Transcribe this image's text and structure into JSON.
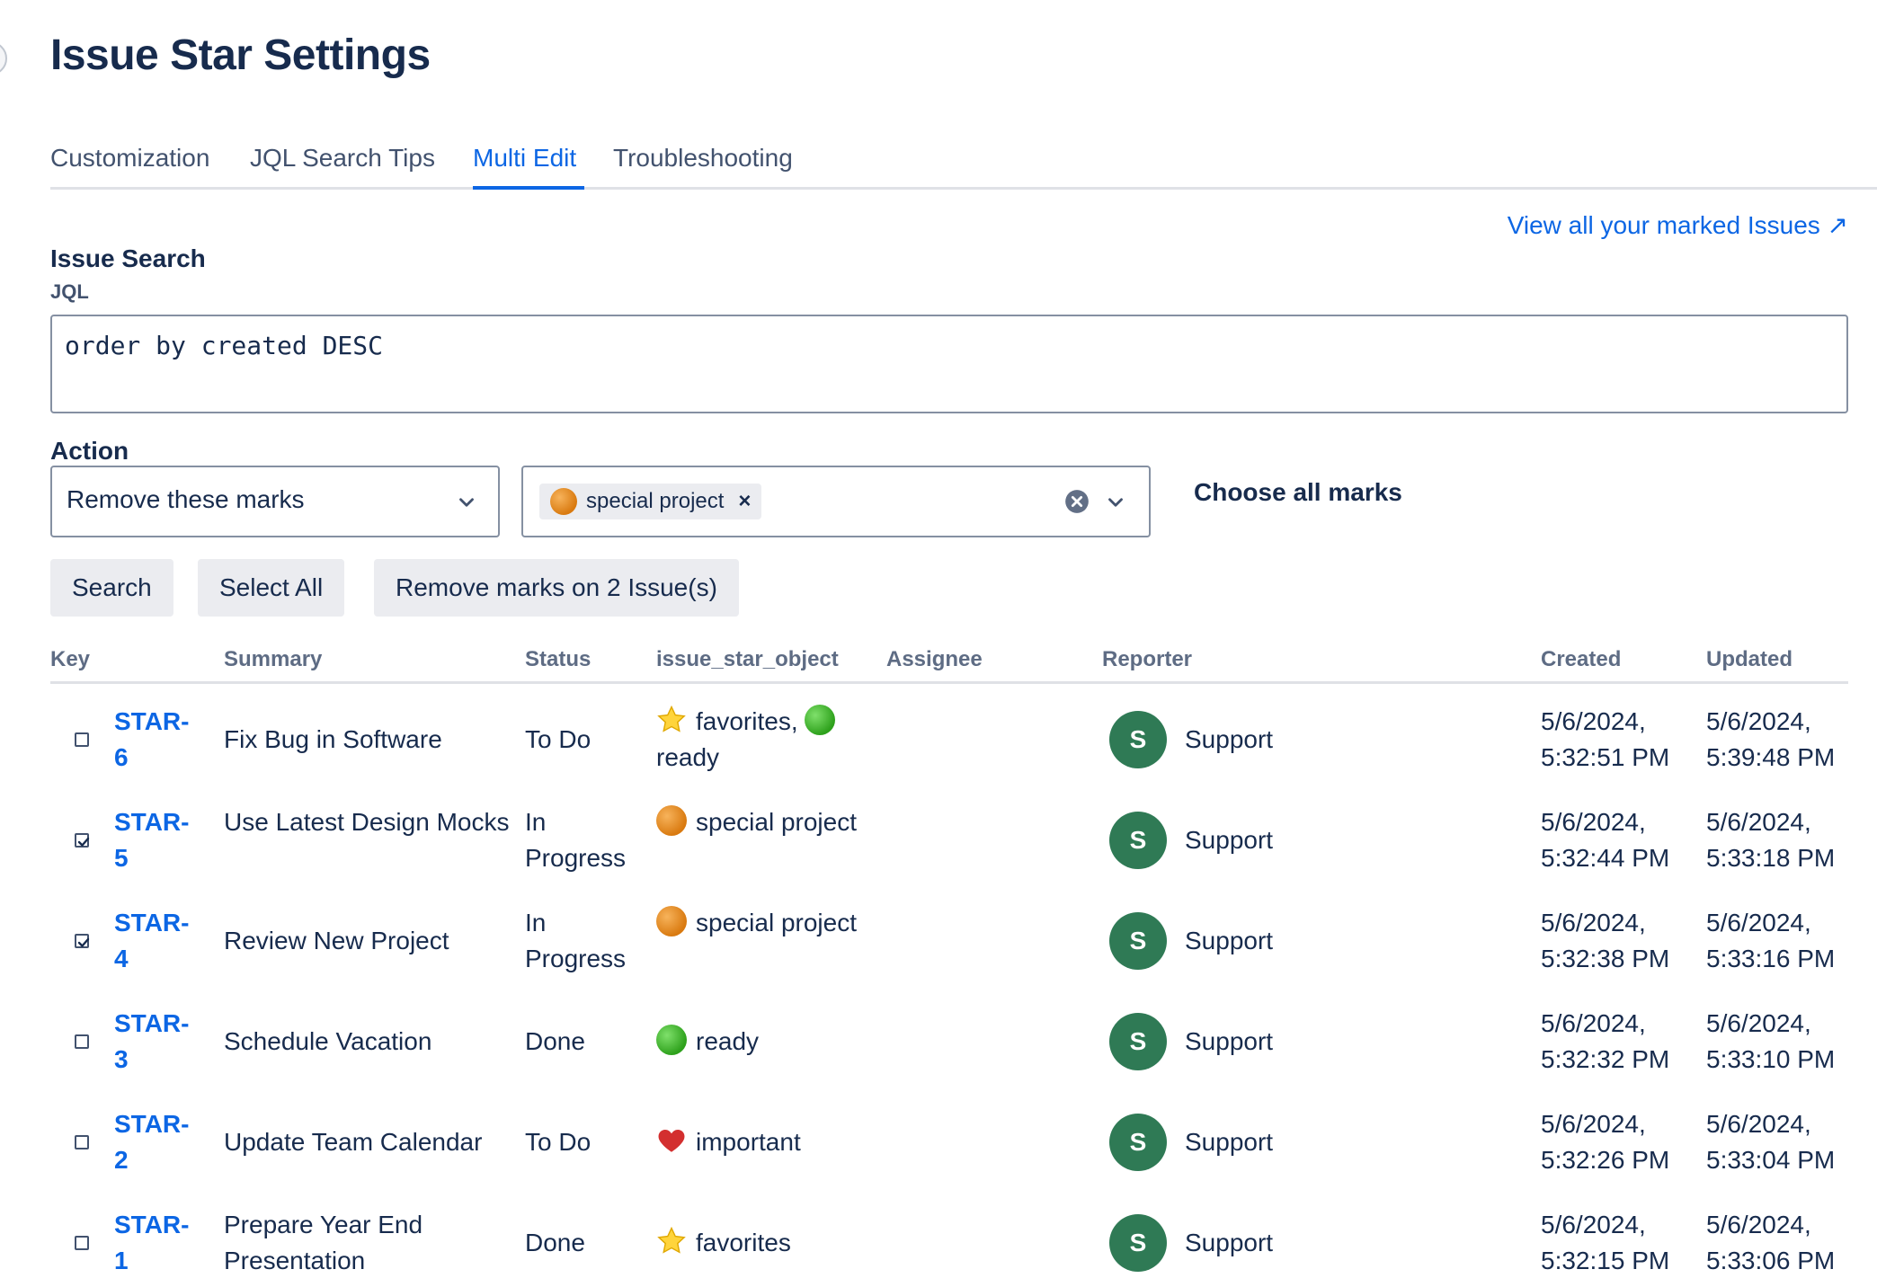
{
  "page": {
    "title": "Issue Star Settings"
  },
  "tabs": [
    {
      "label": "Customization",
      "active": false
    },
    {
      "label": "JQL Search Tips",
      "active": false
    },
    {
      "label": "Multi Edit",
      "active": true
    },
    {
      "label": "Troubleshooting",
      "active": false
    }
  ],
  "view_all_link": "View all your marked Issues ↗",
  "issue_search": {
    "heading": "Issue Search",
    "jql_label": "JQL",
    "jql_value": "order by created DESC"
  },
  "action": {
    "label": "Action",
    "selected": "Remove these marks",
    "marks_selected": [
      {
        "label": "special project",
        "icon": "orange-circle-icon"
      }
    ],
    "choose_all": "Choose all marks"
  },
  "buttons": {
    "search": "Search",
    "select_all": "Select All",
    "remove": "Remove marks on 2 Issue(s)"
  },
  "colors": {
    "link": "#0c66e4",
    "avatar": "#2f7a55",
    "text": "#172b4d"
  },
  "table": {
    "headers": {
      "key": "Key",
      "summary": "Summary",
      "status": "Status",
      "marks": "issue_star_object",
      "assignee": "Assignee",
      "reporter": "Reporter",
      "created": "Created",
      "updated": "Updated"
    },
    "rows": [
      {
        "checked": false,
        "key1": "STAR-",
        "key2": "6",
        "summary": "Fix Bug in Software",
        "status": "To Do",
        "marks": [
          {
            "icon": "star-icon",
            "text": "favorites,"
          },
          {
            "icon": "green-circle-icon",
            "text": "ready"
          }
        ],
        "reporter_initial": "S",
        "reporter": "Support",
        "created1": "5/6/2024,",
        "created2": "5:32:51 PM",
        "updated1": "5/6/2024,",
        "updated2": "5:39:48 PM"
      },
      {
        "checked": true,
        "key1": "STAR-",
        "key2": "5",
        "summary": "Use Latest Design Mocks",
        "status": "In Progress",
        "marks": [
          {
            "icon": "orange-circle-icon",
            "text": "special project"
          }
        ],
        "reporter_initial": "S",
        "reporter": "Support",
        "created1": "5/6/2024,",
        "created2": "5:32:44 PM",
        "updated1": "5/6/2024,",
        "updated2": "5:33:18 PM"
      },
      {
        "checked": true,
        "key1": "STAR-",
        "key2": "4",
        "summary": "Review New Project",
        "status": "In Progress",
        "marks": [
          {
            "icon": "orange-circle-icon",
            "text": "special project"
          }
        ],
        "reporter_initial": "S",
        "reporter": "Support",
        "created1": "5/6/2024,",
        "created2": "5:32:38 PM",
        "updated1": "5/6/2024,",
        "updated2": "5:33:16 PM"
      },
      {
        "checked": false,
        "key1": "STAR-",
        "key2": "3",
        "summary": "Schedule Vacation",
        "status": "Done",
        "marks": [
          {
            "icon": "green-circle-icon",
            "text": "ready"
          }
        ],
        "reporter_initial": "S",
        "reporter": "Support",
        "created1": "5/6/2024,",
        "created2": "5:32:32 PM",
        "updated1": "5/6/2024,",
        "updated2": "5:33:10 PM"
      },
      {
        "checked": false,
        "key1": "STAR-",
        "key2": "2",
        "summary": "Update Team Calendar",
        "status": "To Do",
        "marks": [
          {
            "icon": "heart-icon",
            "text": "important"
          }
        ],
        "reporter_initial": "S",
        "reporter": "Support",
        "created1": "5/6/2024,",
        "created2": "5:32:26 PM",
        "updated1": "5/6/2024,",
        "updated2": "5:33:04 PM"
      },
      {
        "checked": false,
        "key1": "STAR-",
        "key2": "1",
        "summary": "Prepare Year End Presentation",
        "status": "Done",
        "marks": [
          {
            "icon": "star-icon",
            "text": "favorites"
          }
        ],
        "reporter_initial": "S",
        "reporter": "Support",
        "created1": "5/6/2024,",
        "created2": "5:32:15 PM",
        "updated1": "5/6/2024,",
        "updated2": "5:33:06 PM"
      }
    ]
  }
}
